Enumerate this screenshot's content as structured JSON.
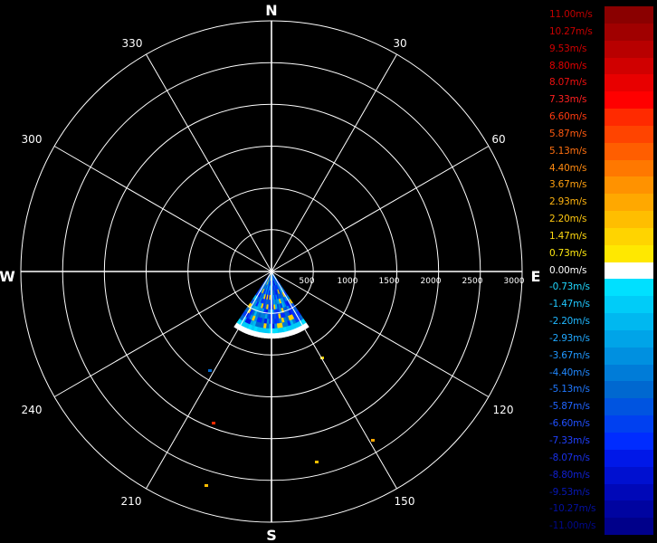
{
  "compass": {
    "north": "N",
    "south": "S",
    "east": "E",
    "west": "W",
    "degree_labels": [
      "30",
      "60",
      "120",
      "150",
      "210",
      "240",
      "300",
      "330"
    ]
  },
  "range_labels": [
    "500",
    "1000",
    "1500",
    "2000",
    "2500",
    "3000"
  ],
  "chart_data": {
    "type": "heatmap",
    "projection": "polar",
    "range_max": 3000,
    "range_rings": [
      500,
      1000,
      1500,
      2000,
      2500,
      3000
    ],
    "sector": {
      "azimuth_start_deg": 146,
      "azimuth_end_deg": 214,
      "range_start": 0,
      "range_end": 800
    },
    "value_unit": "m/s",
    "value_range": [
      -11.0,
      11.0
    ]
  },
  "legend": {
    "items": [
      {
        "label": "11.00m/s",
        "color": "#8a0000",
        "text_color": "#c00000"
      },
      {
        "label": "10.27m/s",
        "color": "#a00000",
        "text_color": "#c80000"
      },
      {
        "label": "9.53m/s",
        "color": "#b80000",
        "text_color": "#d00000"
      },
      {
        "label": "8.80m/s",
        "color": "#d00000",
        "text_color": "#e00000"
      },
      {
        "label": "8.07m/s",
        "color": "#e80000",
        "text_color": "#f01010"
      },
      {
        "label": "7.33m/s",
        "color": "#ff0000",
        "text_color": "#ff2020"
      },
      {
        "label": "6.60m/s",
        "color": "#ff2a00",
        "text_color": "#ff3a10"
      },
      {
        "label": "5.87m/s",
        "color": "#ff4400",
        "text_color": "#ff5a10"
      },
      {
        "label": "5.13m/s",
        "color": "#ff5e00",
        "text_color": "#ff7010"
      },
      {
        "label": "4.40m/s",
        "color": "#ff7800",
        "text_color": "#ff8a10"
      },
      {
        "label": "3.67m/s",
        "color": "#ff9200",
        "text_color": "#ffa010"
      },
      {
        "label": "2.93m/s",
        "color": "#ffa800",
        "text_color": "#ffb410"
      },
      {
        "label": "2.20m/s",
        "color": "#ffbe00",
        "text_color": "#ffc810"
      },
      {
        "label": "1.47m/s",
        "color": "#ffd400",
        "text_color": "#ffd810"
      },
      {
        "label": "0.73m/s",
        "color": "#ffe800",
        "text_color": "#ffe810"
      },
      {
        "label": "0.00m/s",
        "color": "#ffffff",
        "text_color": "#ffffff"
      },
      {
        "label": "-0.73m/s",
        "color": "#00e0ff",
        "text_color": "#20d8ff"
      },
      {
        "label": "-1.47m/s",
        "color": "#00ccf8",
        "text_color": "#20c8ff"
      },
      {
        "label": "-2.20m/s",
        "color": "#00b8f0",
        "text_color": "#20b8ff"
      },
      {
        "label": "-2.93m/s",
        "color": "#00a4e8",
        "text_color": "#20a8ff"
      },
      {
        "label": "-3.67m/s",
        "color": "#0090e0",
        "text_color": "#2098ff"
      },
      {
        "label": "-4.40m/s",
        "color": "#007cd8",
        "text_color": "#2088ff"
      },
      {
        "label": "-5.13m/s",
        "color": "#0068d0",
        "text_color": "#2078ff"
      },
      {
        "label": "-5.87m/s",
        "color": "#0054e0",
        "text_color": "#2064ff"
      },
      {
        "label": "-6.60m/s",
        "color": "#0040f0",
        "text_color": "#2050ff"
      },
      {
        "label": "-7.33m/s",
        "color": "#002cff",
        "text_color": "#2040ff"
      },
      {
        "label": "-8.07m/s",
        "color": "#0018e8",
        "text_color": "#1830e8"
      },
      {
        "label": "-8.80m/s",
        "color": "#0010d0",
        "text_color": "#1020d0"
      },
      {
        "label": "-9.53m/s",
        "color": "#0008b8",
        "text_color": "#0818b8"
      },
      {
        "label": "-10.27m/s",
        "color": "#0004a0",
        "text_color": "#0410a0"
      },
      {
        "label": "-11.00m/s",
        "color": "#00008a",
        "text_color": "#00088a"
      }
    ]
  }
}
